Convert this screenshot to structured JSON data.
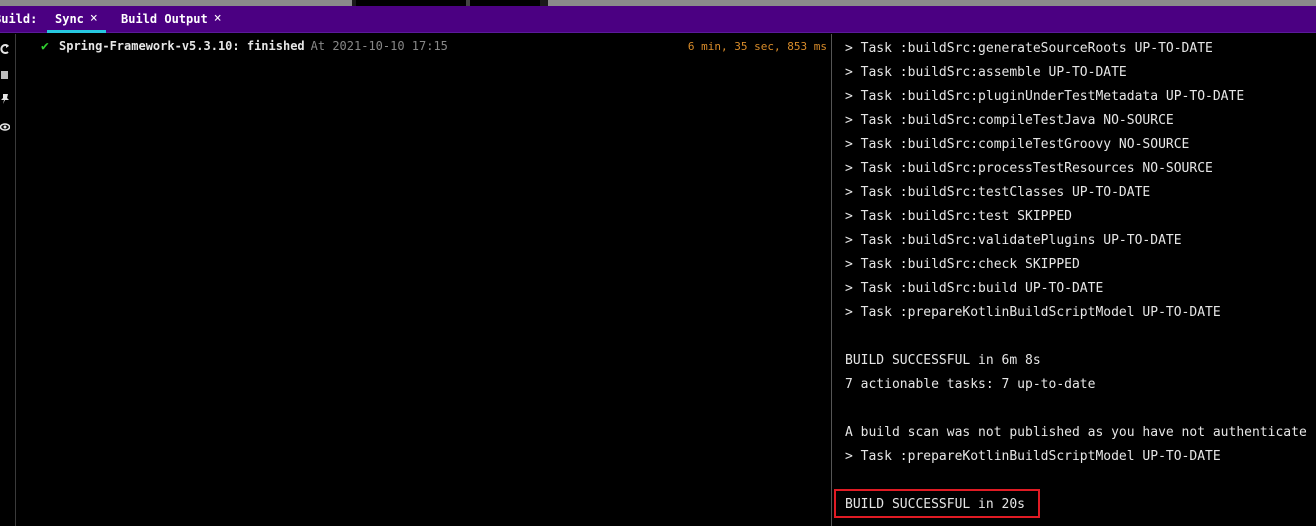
{
  "toolwindow": {
    "label": "Build:",
    "tabs": [
      {
        "label": "Sync",
        "close": "×",
        "active": true
      },
      {
        "label": "Build Output",
        "close": "×",
        "active": false
      }
    ]
  },
  "colors": {
    "tabbar": "#4b0082",
    "active_tab_underline": "#27c8e0",
    "success_check": "#2fcf2f",
    "duration": "#d98c2a",
    "highlight_border": "#e01b24"
  },
  "left_toolbar": {
    "icons": [
      "sync-icon",
      "stop-icon",
      "pin-icon",
      "eye-icon"
    ]
  },
  "build_tree": {
    "status_icon": "check-icon",
    "name": "Spring-Framework-v5.3.10: finished",
    "timestamp": "At 2021-10-10 17:15",
    "duration": "6 min, 35 sec, 853 ms"
  },
  "console": {
    "lines": [
      "> Task :buildSrc:generateSourceRoots UP-TO-DATE",
      "> Task :buildSrc:assemble UP-TO-DATE",
      "> Task :buildSrc:pluginUnderTestMetadata UP-TO-DATE",
      "> Task :buildSrc:compileTestJava NO-SOURCE",
      "> Task :buildSrc:compileTestGroovy NO-SOURCE",
      "> Task :buildSrc:processTestResources NO-SOURCE",
      "> Task :buildSrc:testClasses UP-TO-DATE",
      "> Task :buildSrc:test SKIPPED",
      "> Task :buildSrc:validatePlugins UP-TO-DATE",
      "> Task :buildSrc:check SKIPPED",
      "> Task :buildSrc:build UP-TO-DATE",
      "> Task :prepareKotlinBuildScriptModel UP-TO-DATE",
      "",
      "BUILD SUCCESSFUL in 6m 8s",
      "7 actionable tasks: 7 up-to-date",
      "",
      "A build scan was not published as you have not authenticate",
      "> Task :prepareKotlinBuildScriptModel UP-TO-DATE",
      "",
      "BUILD SUCCESSFUL in 20s"
    ]
  }
}
